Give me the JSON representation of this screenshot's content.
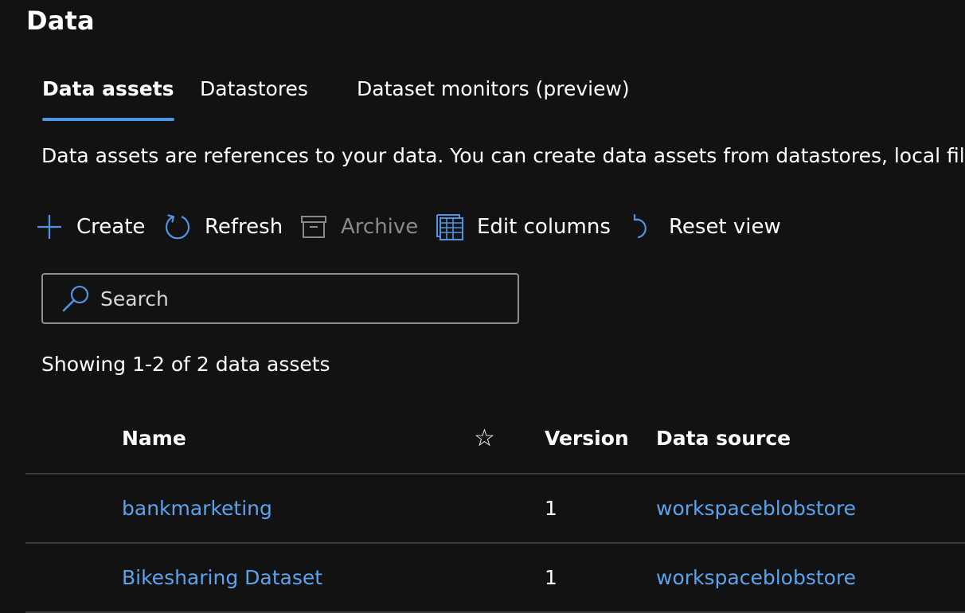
{
  "header": {
    "title": "Data"
  },
  "tabs": [
    {
      "label": "Data assets",
      "active": true
    },
    {
      "label": "Datastores",
      "active": false
    },
    {
      "label": "Dataset monitors (preview)",
      "active": false
    }
  ],
  "description": "Data assets are references to your data. You can create data assets from datastores, local files, p",
  "toolbar": {
    "create_label": "Create",
    "refresh_label": "Refresh",
    "archive_label": "Archive",
    "edit_columns_label": "Edit columns",
    "reset_view_label": "Reset view"
  },
  "search": {
    "placeholder": "Search",
    "value": ""
  },
  "count_text": "Showing 1-2 of 2 data assets",
  "table": {
    "columns": {
      "name": "Name",
      "favorite": "☆",
      "version": "Version",
      "data_source": "Data source"
    },
    "rows": [
      {
        "name": "bankmarketing",
        "version": "1",
        "data_source": "workspaceblobstore"
      },
      {
        "name": "Bikesharing Dataset",
        "version": "1",
        "data_source": "workspaceblobstore"
      }
    ]
  },
  "colors": {
    "background": "#121212",
    "accent": "#4f94e0",
    "link": "#5aa3ee",
    "divider": "#3a3a3a",
    "disabled": "#8a8a8a"
  },
  "icons": {
    "create": "plus-icon",
    "refresh": "refresh-icon",
    "archive": "archive-icon",
    "edit_columns": "table-columns-icon",
    "reset_view": "undo-icon",
    "search": "search-icon",
    "favorite": "star-icon"
  }
}
